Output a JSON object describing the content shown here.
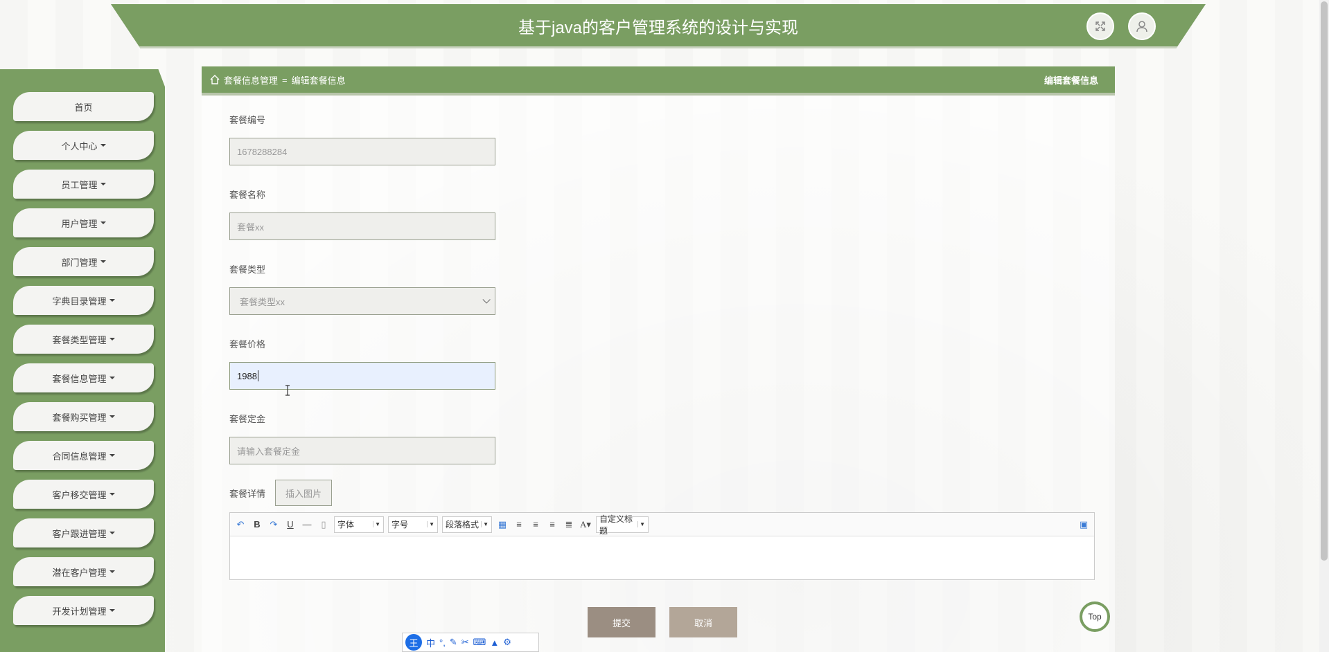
{
  "header": {
    "title": "基于java的客户管理系统的设计与实现",
    "fullscreen_icon": "expand-icon",
    "user_icon": "user-icon"
  },
  "sidebar": {
    "items": [
      {
        "label": "首页",
        "has_caret": false
      },
      {
        "label": "个人中心",
        "has_caret": true
      },
      {
        "label": "员工管理",
        "has_caret": true
      },
      {
        "label": "用户管理",
        "has_caret": true
      },
      {
        "label": "部门管理",
        "has_caret": true
      },
      {
        "label": "字典目录管理",
        "has_caret": true
      },
      {
        "label": "套餐类型管理",
        "has_caret": true
      },
      {
        "label": "套餐信息管理",
        "has_caret": true
      },
      {
        "label": "套餐购买管理",
        "has_caret": true
      },
      {
        "label": "合同信息管理",
        "has_caret": true
      },
      {
        "label": "客户移交管理",
        "has_caret": true
      },
      {
        "label": "客户跟进管理",
        "has_caret": true
      },
      {
        "label": "潜在客户管理",
        "has_caret": true
      },
      {
        "label": "开发计划管理",
        "has_caret": true
      }
    ]
  },
  "breadcrumb": {
    "home": "套餐信息管理",
    "separator": "=",
    "current": "编辑套餐信息",
    "right_title": "编辑套餐信息"
  },
  "form": {
    "code": {
      "label": "套餐编号",
      "value": "1678288284"
    },
    "name": {
      "label": "套餐名称",
      "value": "套餐xx"
    },
    "type": {
      "label": "套餐类型",
      "value": "套餐类型xx"
    },
    "price": {
      "label": "套餐价格",
      "value": "1988"
    },
    "deposit": {
      "label": "套餐定金",
      "placeholder": "请输入套餐定金"
    },
    "detail": {
      "label": "套餐详情",
      "insert_image": "插入图片"
    }
  },
  "editor": {
    "font_label": "字体",
    "size_label": "字号",
    "paragraph_label": "段落格式",
    "custom_title_label": "自定义标题"
  },
  "actions": {
    "submit": "提交",
    "cancel": "取消",
    "top": "Top"
  },
  "ime": {
    "logo": "王",
    "mode": "中"
  },
  "colors": {
    "primary": "#7a9e62",
    "submit": "#9b8e82",
    "cancel": "#b3a698"
  }
}
